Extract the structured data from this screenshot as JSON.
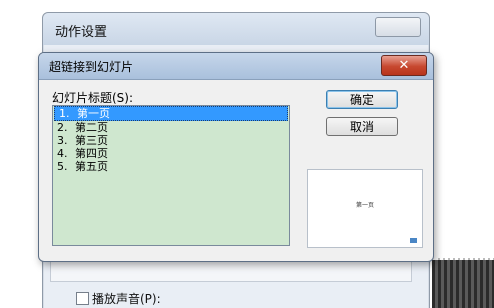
{
  "background_dialog": {
    "title": "动作设置",
    "checkbox_label": "播放声音(P):"
  },
  "dialog": {
    "title": "超链接到幻灯片",
    "close_glyph": "✕",
    "list_label": "幻灯片标题(S):",
    "slides": [
      {
        "num": "1.",
        "title": "第一页",
        "selected": true
      },
      {
        "num": "2.",
        "title": "第二页",
        "selected": false
      },
      {
        "num": "3.",
        "title": "第三页",
        "selected": false
      },
      {
        "num": "4.",
        "title": "第四页",
        "selected": false
      },
      {
        "num": "5.",
        "title": "第五页",
        "selected": false
      }
    ],
    "ok_label": "确定",
    "cancel_label": "取消",
    "preview_text": "第一页"
  },
  "colors": {
    "list_background": "#cfe7cf",
    "selection": "#3399ff",
    "close_button": "#c7482f"
  }
}
